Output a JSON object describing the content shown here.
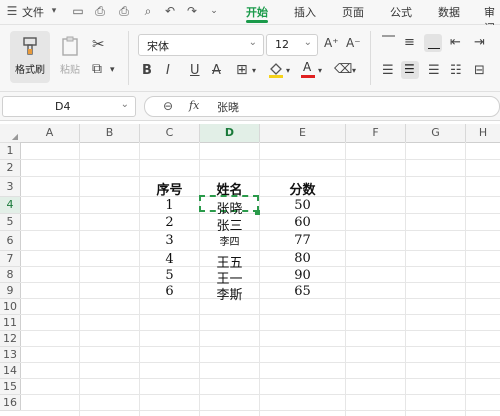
{
  "menubar": {
    "file_label": "文件",
    "tabs": [
      "开始",
      "插入",
      "页面",
      "公式",
      "数据",
      "审阅"
    ]
  },
  "ribbon": {
    "format_painter": "格式刷",
    "paste": "粘贴",
    "font_name": "宋体",
    "font_size": "12",
    "bold": "B",
    "italic": "I",
    "underline": "U",
    "strike": "A"
  },
  "formula_bar": {
    "name_box": "D4",
    "fx_label": "fx",
    "content": "张晓"
  },
  "sheet": {
    "columns": [
      "A",
      "B",
      "C",
      "D",
      "E",
      "F",
      "G",
      "H"
    ],
    "rows": [
      "1",
      "2",
      "3",
      "4",
      "5",
      "6",
      "7",
      "8",
      "9",
      "10",
      "11",
      "12",
      "13",
      "14",
      "15",
      "16"
    ],
    "header": {
      "seq": "序号",
      "name": "姓名",
      "score": "分数"
    },
    "records": [
      {
        "seq": "1",
        "name": "张晓",
        "score": "50"
      },
      {
        "seq": "2",
        "name": "张三",
        "score": "60"
      },
      {
        "seq": "3",
        "name": "李四",
        "score": "77"
      },
      {
        "seq": "4",
        "name": "王五",
        "score": "80"
      },
      {
        "seq": "5",
        "name": "王一",
        "score": "90"
      },
      {
        "seq": "6",
        "name": "李斯",
        "score": "65"
      }
    ]
  },
  "colors": {
    "accent": "#1a9a4a",
    "selection_bg": "#e2efe7"
  }
}
